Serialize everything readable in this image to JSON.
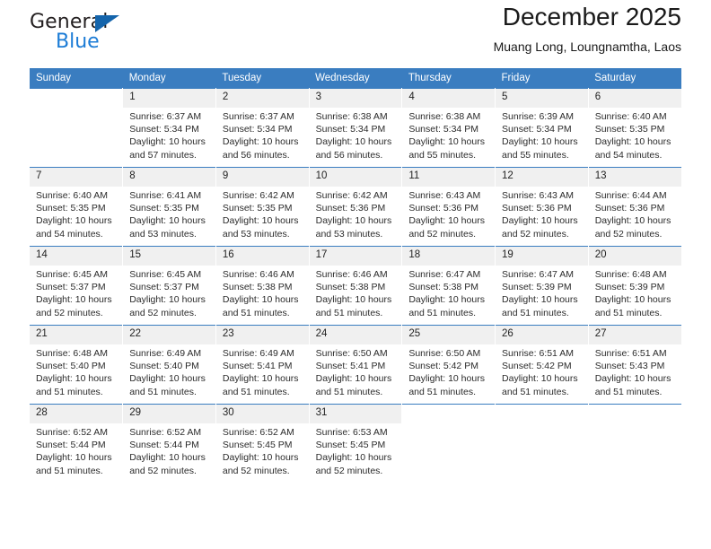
{
  "logo": {
    "word_top": "General",
    "word_bottom": "Blue",
    "triangle_color": "#1464ab",
    "blue_text_color": "#1c7cd6"
  },
  "header": {
    "title": "December 2025",
    "subtitle": "Muang Long, Loungnamtha, Laos"
  },
  "theme": {
    "header_blue": "#3a7dc0",
    "daynum_band": "#f0f0f0"
  },
  "calendar": {
    "weekday_headers": [
      "Sunday",
      "Monday",
      "Tuesday",
      "Wednesday",
      "Thursday",
      "Friday",
      "Saturday"
    ],
    "weeks": [
      [
        {
          "day": "",
          "sunrise": "",
          "sunset": "",
          "daylight1": "",
          "daylight2": ""
        },
        {
          "day": "1",
          "sunrise": "Sunrise: 6:37 AM",
          "sunset": "Sunset: 5:34 PM",
          "daylight1": "Daylight: 10 hours",
          "daylight2": "and 57 minutes."
        },
        {
          "day": "2",
          "sunrise": "Sunrise: 6:37 AM",
          "sunset": "Sunset: 5:34 PM",
          "daylight1": "Daylight: 10 hours",
          "daylight2": "and 56 minutes."
        },
        {
          "day": "3",
          "sunrise": "Sunrise: 6:38 AM",
          "sunset": "Sunset: 5:34 PM",
          "daylight1": "Daylight: 10 hours",
          "daylight2": "and 56 minutes."
        },
        {
          "day": "4",
          "sunrise": "Sunrise: 6:38 AM",
          "sunset": "Sunset: 5:34 PM",
          "daylight1": "Daylight: 10 hours",
          "daylight2": "and 55 minutes."
        },
        {
          "day": "5",
          "sunrise": "Sunrise: 6:39 AM",
          "sunset": "Sunset: 5:34 PM",
          "daylight1": "Daylight: 10 hours",
          "daylight2": "and 55 minutes."
        },
        {
          "day": "6",
          "sunrise": "Sunrise: 6:40 AM",
          "sunset": "Sunset: 5:35 PM",
          "daylight1": "Daylight: 10 hours",
          "daylight2": "and 54 minutes."
        }
      ],
      [
        {
          "day": "7",
          "sunrise": "Sunrise: 6:40 AM",
          "sunset": "Sunset: 5:35 PM",
          "daylight1": "Daylight: 10 hours",
          "daylight2": "and 54 minutes."
        },
        {
          "day": "8",
          "sunrise": "Sunrise: 6:41 AM",
          "sunset": "Sunset: 5:35 PM",
          "daylight1": "Daylight: 10 hours",
          "daylight2": "and 53 minutes."
        },
        {
          "day": "9",
          "sunrise": "Sunrise: 6:42 AM",
          "sunset": "Sunset: 5:35 PM",
          "daylight1": "Daylight: 10 hours",
          "daylight2": "and 53 minutes."
        },
        {
          "day": "10",
          "sunrise": "Sunrise: 6:42 AM",
          "sunset": "Sunset: 5:36 PM",
          "daylight1": "Daylight: 10 hours",
          "daylight2": "and 53 minutes."
        },
        {
          "day": "11",
          "sunrise": "Sunrise: 6:43 AM",
          "sunset": "Sunset: 5:36 PM",
          "daylight1": "Daylight: 10 hours",
          "daylight2": "and 52 minutes."
        },
        {
          "day": "12",
          "sunrise": "Sunrise: 6:43 AM",
          "sunset": "Sunset: 5:36 PM",
          "daylight1": "Daylight: 10 hours",
          "daylight2": "and 52 minutes."
        },
        {
          "day": "13",
          "sunrise": "Sunrise: 6:44 AM",
          "sunset": "Sunset: 5:36 PM",
          "daylight1": "Daylight: 10 hours",
          "daylight2": "and 52 minutes."
        }
      ],
      [
        {
          "day": "14",
          "sunrise": "Sunrise: 6:45 AM",
          "sunset": "Sunset: 5:37 PM",
          "daylight1": "Daylight: 10 hours",
          "daylight2": "and 52 minutes."
        },
        {
          "day": "15",
          "sunrise": "Sunrise: 6:45 AM",
          "sunset": "Sunset: 5:37 PM",
          "daylight1": "Daylight: 10 hours",
          "daylight2": "and 52 minutes."
        },
        {
          "day": "16",
          "sunrise": "Sunrise: 6:46 AM",
          "sunset": "Sunset: 5:38 PM",
          "daylight1": "Daylight: 10 hours",
          "daylight2": "and 51 minutes."
        },
        {
          "day": "17",
          "sunrise": "Sunrise: 6:46 AM",
          "sunset": "Sunset: 5:38 PM",
          "daylight1": "Daylight: 10 hours",
          "daylight2": "and 51 minutes."
        },
        {
          "day": "18",
          "sunrise": "Sunrise: 6:47 AM",
          "sunset": "Sunset: 5:38 PM",
          "daylight1": "Daylight: 10 hours",
          "daylight2": "and 51 minutes."
        },
        {
          "day": "19",
          "sunrise": "Sunrise: 6:47 AM",
          "sunset": "Sunset: 5:39 PM",
          "daylight1": "Daylight: 10 hours",
          "daylight2": "and 51 minutes."
        },
        {
          "day": "20",
          "sunrise": "Sunrise: 6:48 AM",
          "sunset": "Sunset: 5:39 PM",
          "daylight1": "Daylight: 10 hours",
          "daylight2": "and 51 minutes."
        }
      ],
      [
        {
          "day": "21",
          "sunrise": "Sunrise: 6:48 AM",
          "sunset": "Sunset: 5:40 PM",
          "daylight1": "Daylight: 10 hours",
          "daylight2": "and 51 minutes."
        },
        {
          "day": "22",
          "sunrise": "Sunrise: 6:49 AM",
          "sunset": "Sunset: 5:40 PM",
          "daylight1": "Daylight: 10 hours",
          "daylight2": "and 51 minutes."
        },
        {
          "day": "23",
          "sunrise": "Sunrise: 6:49 AM",
          "sunset": "Sunset: 5:41 PM",
          "daylight1": "Daylight: 10 hours",
          "daylight2": "and 51 minutes."
        },
        {
          "day": "24",
          "sunrise": "Sunrise: 6:50 AM",
          "sunset": "Sunset: 5:41 PM",
          "daylight1": "Daylight: 10 hours",
          "daylight2": "and 51 minutes."
        },
        {
          "day": "25",
          "sunrise": "Sunrise: 6:50 AM",
          "sunset": "Sunset: 5:42 PM",
          "daylight1": "Daylight: 10 hours",
          "daylight2": "and 51 minutes."
        },
        {
          "day": "26",
          "sunrise": "Sunrise: 6:51 AM",
          "sunset": "Sunset: 5:42 PM",
          "daylight1": "Daylight: 10 hours",
          "daylight2": "and 51 minutes."
        },
        {
          "day": "27",
          "sunrise": "Sunrise: 6:51 AM",
          "sunset": "Sunset: 5:43 PM",
          "daylight1": "Daylight: 10 hours",
          "daylight2": "and 51 minutes."
        }
      ],
      [
        {
          "day": "28",
          "sunrise": "Sunrise: 6:52 AM",
          "sunset": "Sunset: 5:44 PM",
          "daylight1": "Daylight: 10 hours",
          "daylight2": "and 51 minutes."
        },
        {
          "day": "29",
          "sunrise": "Sunrise: 6:52 AM",
          "sunset": "Sunset: 5:44 PM",
          "daylight1": "Daylight: 10 hours",
          "daylight2": "and 52 minutes."
        },
        {
          "day": "30",
          "sunrise": "Sunrise: 6:52 AM",
          "sunset": "Sunset: 5:45 PM",
          "daylight1": "Daylight: 10 hours",
          "daylight2": "and 52 minutes."
        },
        {
          "day": "31",
          "sunrise": "Sunrise: 6:53 AM",
          "sunset": "Sunset: 5:45 PM",
          "daylight1": "Daylight: 10 hours",
          "daylight2": "and 52 minutes."
        },
        {
          "day": "",
          "sunrise": "",
          "sunset": "",
          "daylight1": "",
          "daylight2": ""
        },
        {
          "day": "",
          "sunrise": "",
          "sunset": "",
          "daylight1": "",
          "daylight2": ""
        },
        {
          "day": "",
          "sunrise": "",
          "sunset": "",
          "daylight1": "",
          "daylight2": ""
        }
      ]
    ]
  }
}
